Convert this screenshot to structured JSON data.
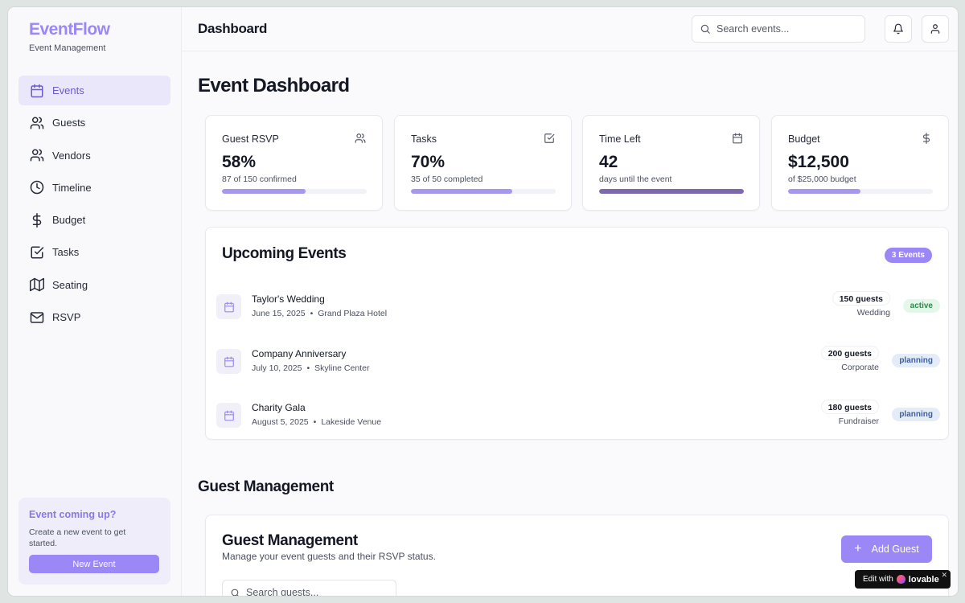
{
  "app": {
    "brand": "EventFlow",
    "brand_sub": "Event Management",
    "accent": "#9b87f5"
  },
  "sidebar": {
    "items": [
      {
        "label": "Events",
        "icon": "calendar-icon",
        "active": true
      },
      {
        "label": "Guests",
        "icon": "users-icon"
      },
      {
        "label": "Vendors",
        "icon": "users-icon"
      },
      {
        "label": "Timeline",
        "icon": "clock-icon"
      },
      {
        "label": "Budget",
        "icon": "dollar-icon"
      },
      {
        "label": "Tasks",
        "icon": "check-square-icon"
      },
      {
        "label": "Seating",
        "icon": "map-icon"
      },
      {
        "label": "RSVP",
        "icon": "mail-icon"
      }
    ],
    "promo": {
      "title": "Event coming up?",
      "text": "Create a new event to get started.",
      "button": "New Event"
    }
  },
  "header": {
    "title": "Dashboard",
    "search_placeholder": "Search events..."
  },
  "main": {
    "page_title": "Event Dashboard",
    "stats": [
      {
        "label": "Guest RSVP",
        "value": "58%",
        "sub": "87 of 150 confirmed",
        "progress": 0.58,
        "icon": "users-icon"
      },
      {
        "label": "Tasks",
        "value": "70%",
        "sub": "35 of 50 completed",
        "progress": 0.7,
        "icon": "check-square-icon"
      },
      {
        "label": "Time Left",
        "value": "42",
        "sub": "days until the event",
        "progress": 1.0,
        "icon": "calendar-icon"
      },
      {
        "label": "Budget",
        "value": "$12,500",
        "sub": "of $25,000 budget",
        "progress": 0.5,
        "icon": "dollar-icon"
      }
    ],
    "upcoming": {
      "title": "Upcoming Events",
      "count_badge": "3 Events",
      "events": [
        {
          "name": "Taylor's Wedding",
          "date": "June 15, 2025",
          "venue": "Grand Plaza Hotel",
          "guests": "150 guests",
          "type": "Wedding",
          "status": "active"
        },
        {
          "name": "Company Anniversary",
          "date": "July 10, 2025",
          "venue": "Skyline Center",
          "guests": "200 guests",
          "type": "Corporate",
          "status": "planning"
        },
        {
          "name": "Charity Gala",
          "date": "August 5, 2025",
          "venue": "Lakeside Venue",
          "guests": "180 guests",
          "type": "Fundraiser",
          "status": "planning"
        }
      ]
    },
    "guest_section_heading": "Guest Management",
    "guest_card": {
      "title": "Guest Management",
      "subtitle": "Manage your event guests and their RSVP status.",
      "add_button": "Add Guest",
      "search_placeholder": "Search guests..."
    }
  },
  "lovable_badge": {
    "prefix": "Edit with",
    "brand": "lovable",
    "close": "✕"
  }
}
